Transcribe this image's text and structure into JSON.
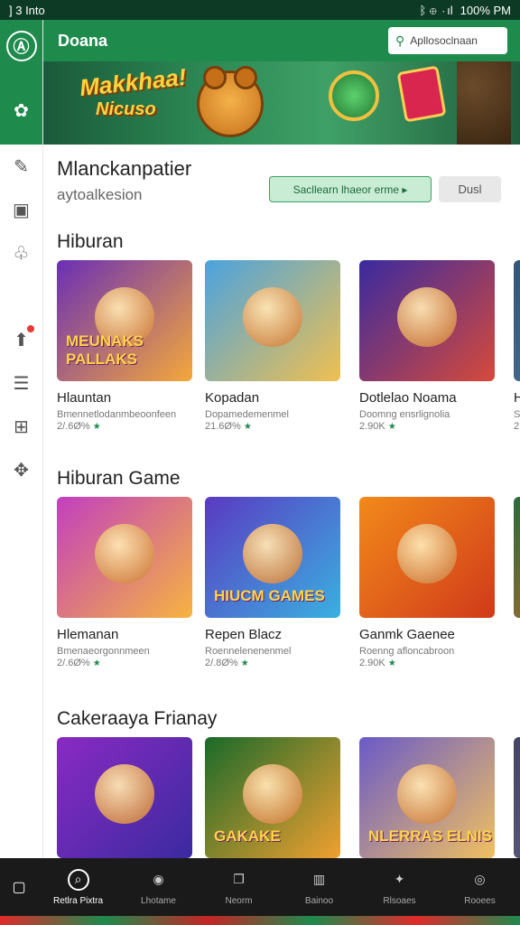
{
  "status_bar": {
    "left": "] 3 Into",
    "icons": "ᛒ ⊕ ⋅ıl",
    "right": "100% PM"
  },
  "header": {
    "title": "Doana",
    "search_label": "Apllosoclnaan"
  },
  "banner": {
    "title": "Makkhaa!",
    "subtitle": "Nicuso"
  },
  "rail": {
    "logo": "Ⓐ",
    "gear": "✿"
  },
  "hero": {
    "title": "Mlanckanpatier",
    "subtitle": "aytoalkesion",
    "primary_button": "Sacllearn lhaeor erme ▸",
    "secondary_button": "Dusl"
  },
  "categories": [
    {
      "title": "Hiburan",
      "items": [
        {
          "thumb_text": "MEUNAKS PALLAKS",
          "title": "Hlauntan",
          "desc": "Bmennetlodanmbeoonfeen",
          "rating": "2/.6Ø% ",
          "colors": [
            "#6a2fb5",
            "#f4a83a"
          ]
        },
        {
          "thumb_text": "",
          "title": "Kopadan",
          "desc": "Dopamedemenmel",
          "rating": "21.6Ø% ",
          "colors": [
            "#4aa3e0",
            "#f0c050"
          ]
        },
        {
          "thumb_text": "",
          "title": "Dotlelao Noama",
          "desc": "Doomng ensrlignolia",
          "rating": "2.90K ",
          "colors": [
            "#3a2aa0",
            "#d64a3a"
          ]
        },
        {
          "thumb_text": "",
          "title": "H",
          "desc": "S",
          "rating": "2",
          "colors": [
            "#335577",
            "#557799"
          ]
        }
      ]
    },
    {
      "title": "Hiburan Game",
      "items": [
        {
          "thumb_text": "",
          "title": "Hlemanan",
          "desc": "Bmenaeorgonnmeen",
          "rating": "2/.6Ø% ",
          "colors": [
            "#c23fbf",
            "#f6b440"
          ]
        },
        {
          "thumb_text": "HIUCM GAMES",
          "title": "Repen Blacz",
          "desc": "Roennelenenenmel",
          "rating": "2/.8Ø% ",
          "colors": [
            "#5a3ac2",
            "#3ab0e0"
          ]
        },
        {
          "thumb_text": "",
          "title": "Ganmk Gaenee",
          "desc": "Roenng afloncabroon",
          "rating": "2.90K ",
          "colors": [
            "#f28a1a",
            "#d03a1a"
          ]
        },
        {
          "thumb_text": "",
          "title": "",
          "desc": "",
          "rating": "",
          "colors": [
            "#2a6a3a",
            "#e06a2a"
          ]
        }
      ]
    },
    {
      "title": "Cakeraaya Frianay",
      "items": [
        {
          "thumb_text": "",
          "title": "",
          "desc": "",
          "rating": "",
          "colors": [
            "#8a2ac2",
            "#3a2aa0"
          ]
        },
        {
          "thumb_text": "GAKAKE",
          "title": "",
          "desc": "",
          "rating": "",
          "colors": [
            "#1a6a2a",
            "#f0a030"
          ]
        },
        {
          "thumb_text": "NLERRAS ELNIS",
          "title": "",
          "desc": "",
          "rating": "",
          "colors": [
            "#6a5ac8",
            "#f0c060"
          ]
        },
        {
          "thumb_text": "",
          "title": "",
          "desc": "",
          "rating": "",
          "colors": [
            "#444466",
            "#666688"
          ]
        }
      ]
    }
  ],
  "bottom_nav": [
    {
      "icon": "search-icon",
      "glyph": "⌕",
      "label": "Retlra Pixtra",
      "active": true
    },
    {
      "icon": "game-icon",
      "glyph": "◉",
      "label": "Lhotame",
      "active": false
    },
    {
      "icon": "book-icon",
      "glyph": "❐",
      "label": "Neorm",
      "active": false
    },
    {
      "icon": "library-icon",
      "glyph": "▥",
      "label": "Bainoo",
      "active": false
    },
    {
      "icon": "puzzle-icon",
      "glyph": "✦",
      "label": "Rlsoaes",
      "active": false
    },
    {
      "icon": "compass-icon",
      "glyph": "◎",
      "label": "Rooees",
      "active": false
    }
  ],
  "colors": {
    "brand": "#1e8a4c",
    "nav_bg": "#1a1a1a"
  }
}
